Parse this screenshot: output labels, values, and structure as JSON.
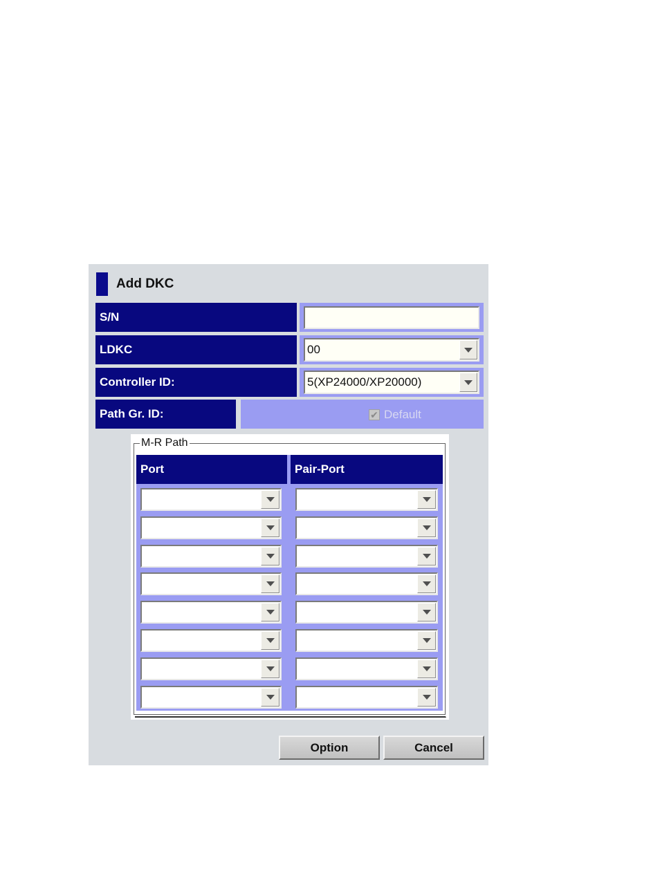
{
  "dialog": {
    "title": "Add DKC",
    "fields": {
      "sn": {
        "label": "S/N",
        "value": ""
      },
      "ldkc": {
        "label": "LDKC",
        "value": "00"
      },
      "controller_id": {
        "label": "Controller ID:",
        "value": "5(XP24000/XP20000)"
      },
      "path_group_id": {
        "label": "Path Gr. ID:",
        "checkbox_label": "Default",
        "checked": true,
        "enabled": false
      }
    },
    "mr_path": {
      "legend": "M-R Path",
      "columns": [
        "Port",
        "Pair-Port"
      ],
      "rows": [
        {
          "port": "",
          "pair_port": ""
        },
        {
          "port": "",
          "pair_port": ""
        },
        {
          "port": "",
          "pair_port": ""
        },
        {
          "port": "",
          "pair_port": ""
        },
        {
          "port": "",
          "pair_port": ""
        },
        {
          "port": "",
          "pair_port": ""
        },
        {
          "port": "",
          "pair_port": ""
        },
        {
          "port": "",
          "pair_port": ""
        }
      ]
    },
    "buttons": {
      "option": "Option",
      "cancel": "Cancel"
    },
    "icons": {
      "dropdown": "chevron-down-icon",
      "checkbox": "checkmark-icon"
    },
    "colors": {
      "label_bg": "#08087f",
      "value_bg": "#9a9cf2",
      "dialog_bg": "#d8dce0"
    }
  }
}
